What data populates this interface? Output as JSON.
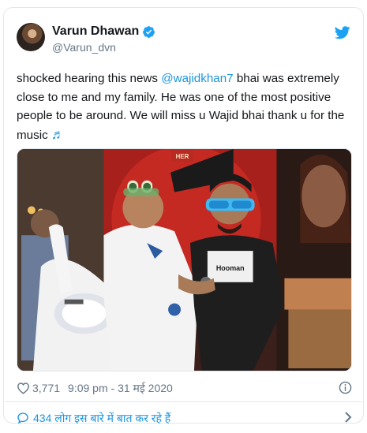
{
  "tweet": {
    "author": {
      "display_name": "Varun Dhawan",
      "handle": "@Varun_dvn",
      "verified": true,
      "avatar_icon": "profile-photo"
    },
    "text_before": "shocked hearing this news ",
    "mention": "@wajidkhan7",
    "text_after": " bhai was extremely close to me and my family. He was one of the most positive people to be around. We will miss u Wajid bhai thank u for the music ",
    "emoji": "♬",
    "photo_signs": {
      "her": "HER",
      "tshirt": "Hooman"
    },
    "likes": "3,771",
    "timestamp": "9:09 pm - 31 मई 2020",
    "replies_text": "434 लोग इस बारे में बात कर रहे हैं"
  },
  "colors": {
    "accent": "#1b95e0",
    "text": "#14171a",
    "muted": "#657786",
    "border": "#e1e8ed"
  },
  "icons": [
    "verified-badge-icon",
    "twitter-bird-icon",
    "heart-icon",
    "info-icon",
    "reply-bubble-icon",
    "chevron-right-icon"
  ]
}
